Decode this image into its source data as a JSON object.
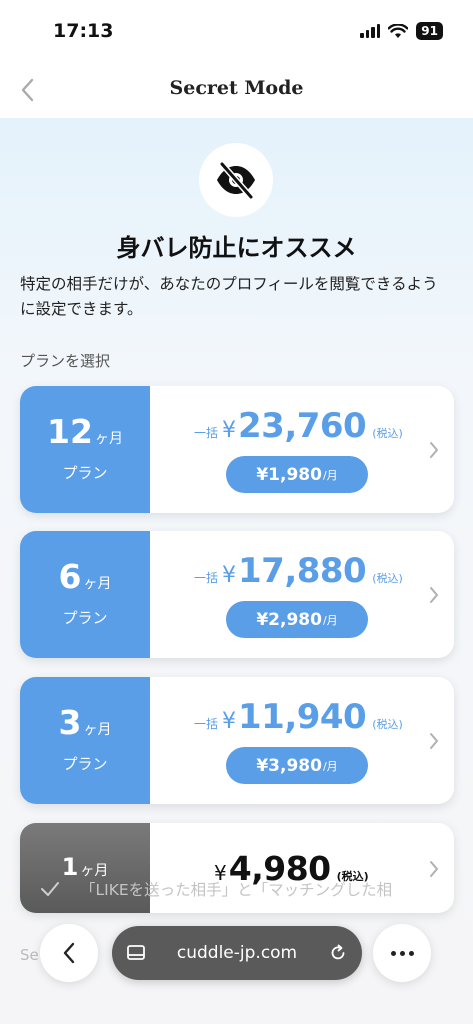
{
  "status": {
    "time": "17:13",
    "battery": "91"
  },
  "nav": {
    "title": "Secret Mode"
  },
  "hero": {
    "icon": "eye-slash-icon",
    "headline": "身バレ防止にオススメ",
    "description": "特定の相手だけが、あなたのプロフィールを閲覧できるように設定できます。"
  },
  "section_label": "プランを選択",
  "plans": [
    {
      "months": "12",
      "unit": "ヶ月",
      "plan_label": "プラン",
      "lump_label": "一括",
      "currency": "¥",
      "price": "23,760",
      "tax_label": "(税込)",
      "monthly": "¥1,980",
      "per_month": "/月",
      "color": "#5a9ee8"
    },
    {
      "months": "6",
      "unit": "ヶ月",
      "plan_label": "プラン",
      "lump_label": "一括",
      "currency": "¥",
      "price": "17,880",
      "tax_label": "(税込)",
      "monthly": "¥2,980",
      "per_month": "/月",
      "color": "#5a9ee8"
    },
    {
      "months": "3",
      "unit": "ヶ月",
      "plan_label": "プラン",
      "lump_label": "一括",
      "currency": "¥",
      "price": "11,940",
      "tax_label": "(税込)",
      "monthly": "¥3,980",
      "per_month": "/月",
      "color": "#5a9ee8"
    },
    {
      "months": "1",
      "unit": "ヶ月",
      "currency": "¥",
      "price": "4,980",
      "tax_label": "(税込)",
      "color": "#6b6b6b"
    }
  ],
  "faded": {
    "section_text": "Se",
    "feature_text": "「LIKEを送った相手」と「マッチングした相"
  },
  "browser": {
    "url": "cuddle-jp.com"
  }
}
